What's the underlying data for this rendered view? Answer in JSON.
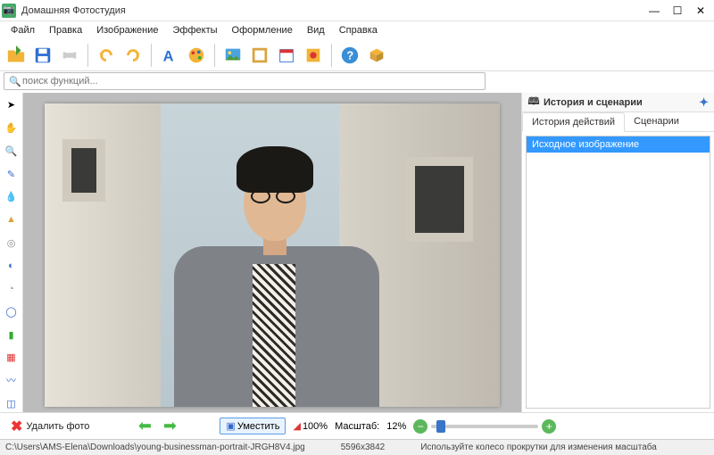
{
  "app": {
    "title": "Домашняя Фотостудия"
  },
  "menu": [
    "Файл",
    "Правка",
    "Изображение",
    "Эффекты",
    "Оформление",
    "Вид",
    "Справка"
  ],
  "search": {
    "placeholder": "поиск функций..."
  },
  "panel": {
    "title": "История и сценарии",
    "tab_history": "История действий",
    "tab_scenarios": "Сценарии",
    "item": "Исходное изображение"
  },
  "bottom": {
    "delete": "Удалить фото",
    "fit": "Уместить",
    "pct": "100%",
    "scale_label": "Масштаб:",
    "scale_value": "12%"
  },
  "status": {
    "path": "C:\\Users\\AMS-Elena\\Downloads\\young-businessman-portrait-JRGH8V4.jpg",
    "dims": "5596x3842",
    "hint": "Используйте колесо прокрутки для изменения масштаба"
  },
  "icons": {
    "open": "open",
    "save": "save",
    "print": "print",
    "undo": "undo",
    "redo": "redo",
    "text": "text",
    "palette": "palette",
    "image": "image",
    "frame": "frame",
    "calendar": "calendar",
    "effect": "effect",
    "help": "help",
    "box": "box"
  }
}
